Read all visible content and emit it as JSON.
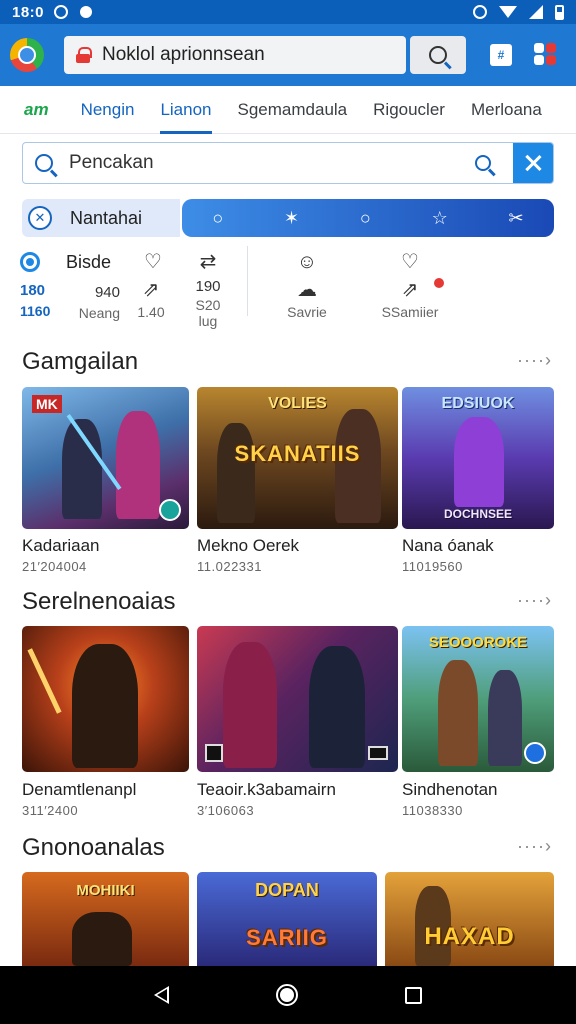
{
  "status_bar": {
    "time": "18:0"
  },
  "browser": {
    "url_text": "Noklol aprionnsean",
    "tabs_count": "#"
  },
  "category_tabs": {
    "logo": "am",
    "items": [
      {
        "label": "Nengin"
      },
      {
        "label": "Lianon"
      },
      {
        "label": "Sgemamdaula"
      },
      {
        "label": "Rigoucler"
      },
      {
        "label": "Merloana"
      }
    ]
  },
  "search": {
    "value": "Pencakan"
  },
  "filter": {
    "chip_label": "Nantahai",
    "strip_icons": [
      "○",
      "✶",
      "○",
      "☆",
      "✂"
    ]
  },
  "stats": {
    "radio_label": "Bisde",
    "radio_val": "180",
    "radio_sub": "1160",
    "col2_val": "940",
    "col2_sub": "Neang",
    "col3_val": "190",
    "col3_sub1": "1.40",
    "col3_sub2": "S20",
    "col3_sub3": "lug",
    "col4_sub": "Savrie",
    "col5_sub": "SSamiier"
  },
  "sections": [
    {
      "title": "Gamgailan",
      "more": "····›",
      "games": [
        {
          "name": "Kadariaan",
          "meta": "21′204004",
          "thumb_top": "MK"
        },
        {
          "name": "Mekno Oerek",
          "meta": "11.022331",
          "thumb_top": "VOLIES",
          "thumb_title": "SKANATIIS"
        },
        {
          "name": "Nana óanak",
          "meta": "11019560",
          "thumb_top": "EDSIUOK",
          "thumb_bottom": "DOCHNSEE"
        }
      ]
    },
    {
      "title": "Serelnenoaias",
      "more": "····›",
      "games": [
        {
          "name": "Denamtlenanpl",
          "meta": "311′2400",
          "thumb_title": ""
        },
        {
          "name": "Teaoir.k3abamairn",
          "meta": "3′106063",
          "thumb_title": ""
        },
        {
          "name": "Sindhenotan",
          "meta": "11038330",
          "thumb_top": "SEOOOROKE"
        }
      ]
    },
    {
      "title": "Gnonoanalas",
      "more": "····›",
      "games": [
        {
          "thumb_top": "MOHIIKI"
        },
        {
          "thumb_top": "DOPAN",
          "thumb_title": "SARIIG"
        },
        {
          "thumb_title": "HAXAD"
        }
      ]
    }
  ],
  "colors": {
    "toolbar": "#1f78d1",
    "accent": "#1565c0",
    "status_bar": "#0b5fb8"
  }
}
